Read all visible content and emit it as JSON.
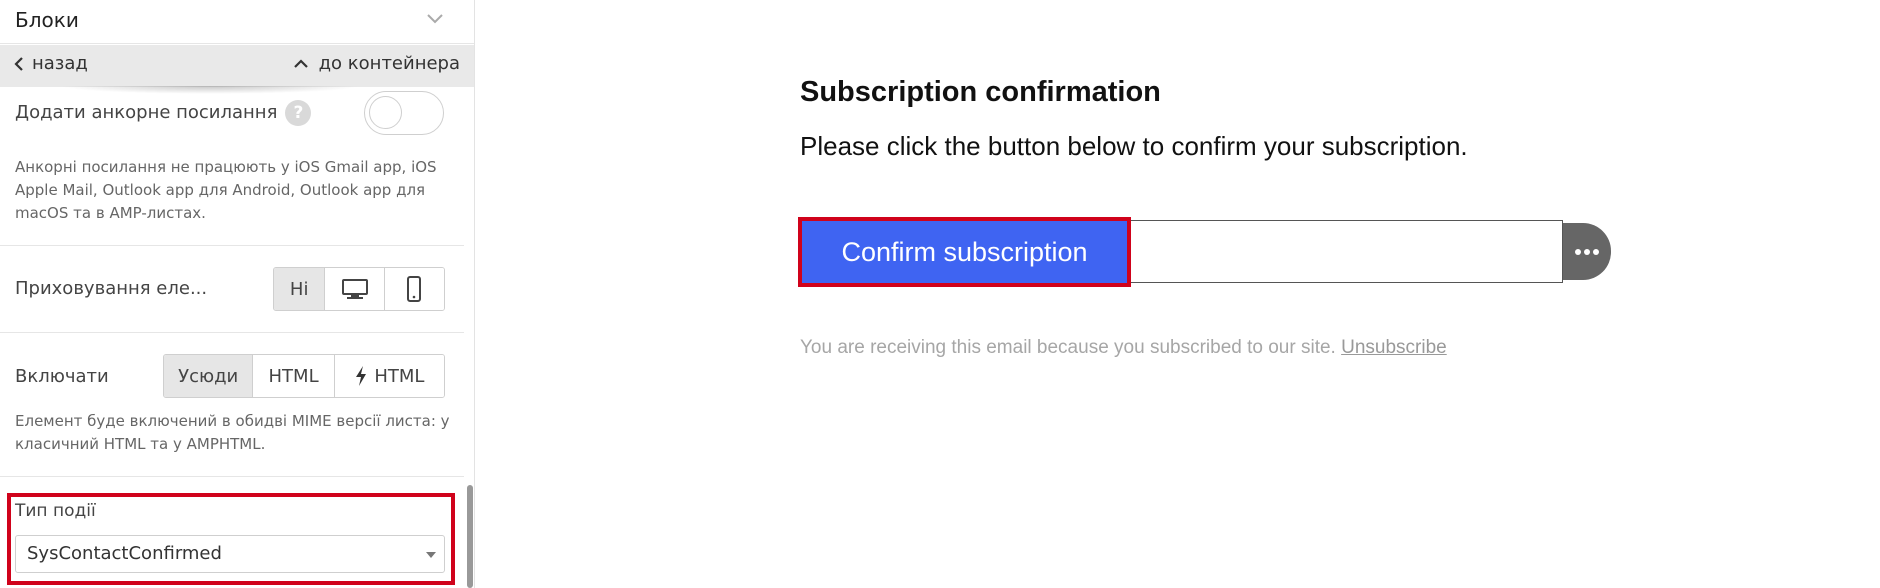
{
  "sidebar": {
    "header_title": "Блоки",
    "nav": {
      "back_label": "назад",
      "up_label": "до контейнера"
    },
    "anchor": {
      "label": "Додати анкорне посилання",
      "help_mark": "?",
      "toggle_on": false,
      "hint_lines": [
        "Анкорні посилання не працюють у iOS Gmail app, iOS",
        "Apple Mail, Outlook app для Android, Outlook app для",
        "macOS та в AMP-листах."
      ]
    },
    "hide": {
      "label": "Приховування еле...",
      "options": [
        "Ні",
        "desktop-icon",
        "mobile-icon"
      ],
      "selected": "Ні"
    },
    "include": {
      "label": "Включати",
      "options": [
        "Усюди",
        "HTML",
        "HTML"
      ],
      "selected": "Усюди",
      "hint_lines": [
        "Елемент буде включений в обидві MIME версії листа: у",
        "класичний HTML та у AMPHTML."
      ]
    },
    "event": {
      "label": "Тип події",
      "value": "SysContactConfirmed"
    }
  },
  "email": {
    "title": "Subscription confirmation",
    "body": "Please click the button below to confirm your subscription.",
    "button_label": "Confirm subscription",
    "footer_text": "You are receiving this email because you subscribed to our site.",
    "footer_link": "Unsubscribe"
  },
  "colors": {
    "button_blue": "#3f64f2",
    "highlight_red": "#d0021b",
    "more_button": "#666666"
  }
}
